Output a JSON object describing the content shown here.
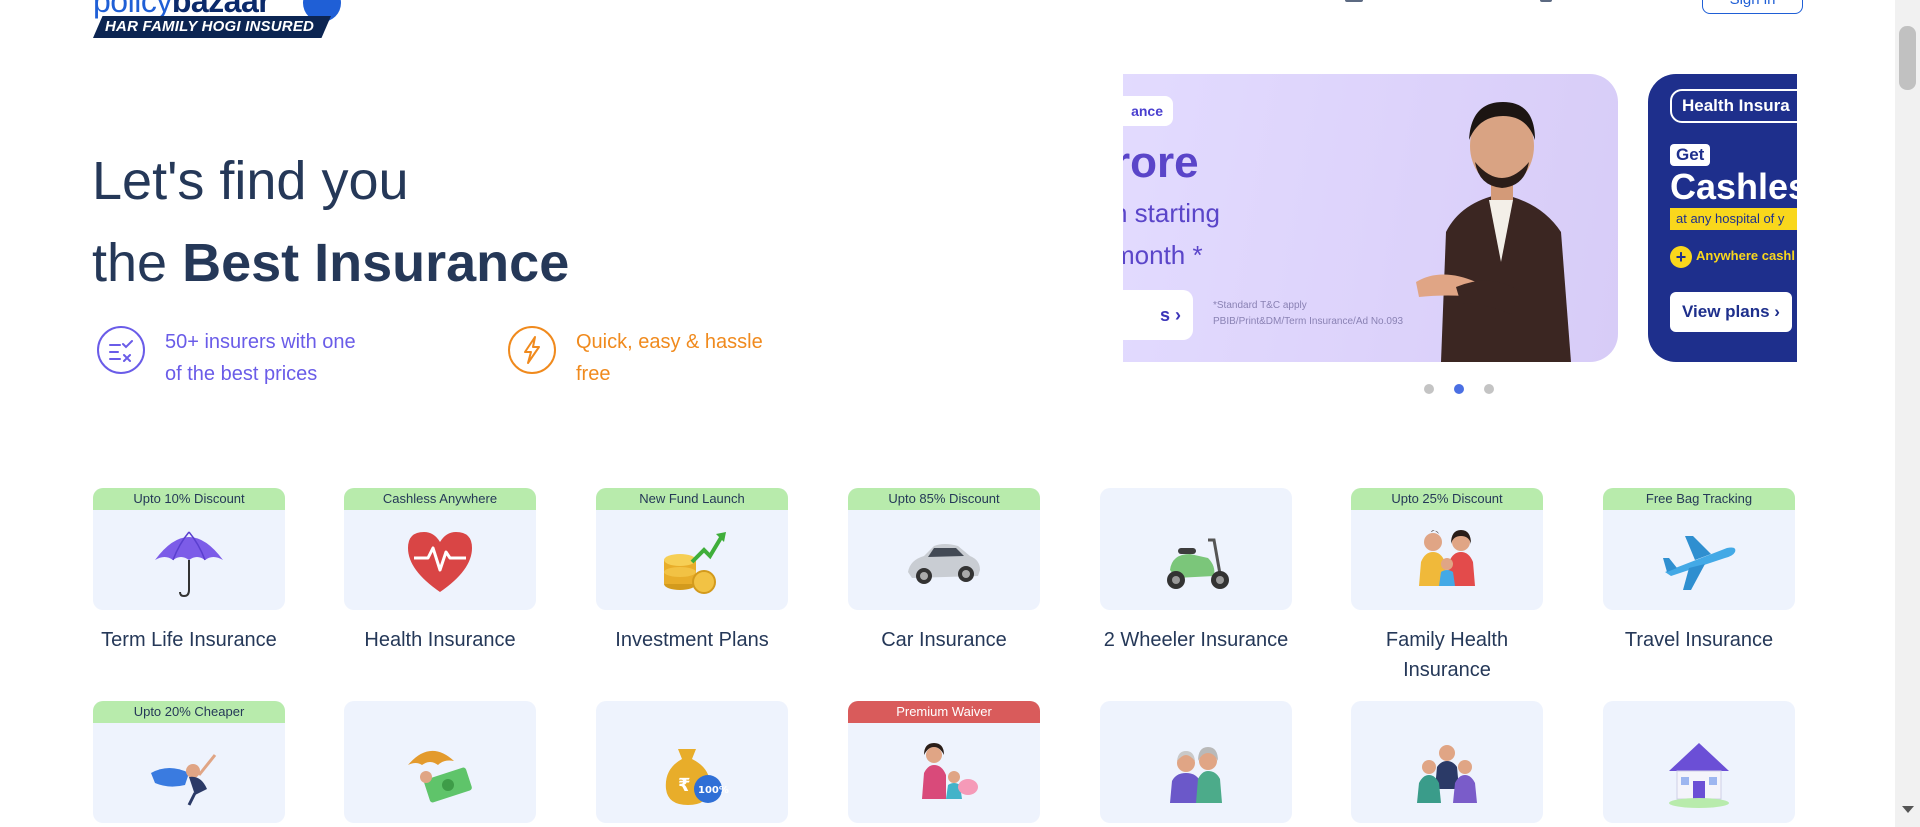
{
  "header": {
    "logo_part1": "policy",
    "logo_part2": "bazaar",
    "logo_tagline": "HAR FAMILY HOGI INSURED",
    "signin_label": "Sign in"
  },
  "hero": {
    "title_line1": "Let's find you",
    "title_line2_prefix": "the ",
    "title_line2_bold": "Best Insurance",
    "features": [
      {
        "icon": "compare-list-icon",
        "text": "50+ insurers with one of the best prices",
        "color": "#6a5ce8"
      },
      {
        "icon": "lightning-icon",
        "text": "Quick, easy & hassle free",
        "color": "#f08a1d"
      }
    ]
  },
  "carousel": {
    "slide1": {
      "badge": "ance",
      "big": "rore",
      "line1": "n starting",
      "line2": "month *",
      "button": "s",
      "tc_line1": "*Standard T&C apply",
      "tc_line2": "PBIB/Print&DM/Term Insurance/Ad No.093"
    },
    "slide2": {
      "badge": "Health Insura",
      "get": "Get",
      "big": "Cashles",
      "yellow": "at any hospital of y",
      "cashless_note": "Anywhere cashl",
      "button": "View plans"
    },
    "active_dot": 2,
    "dot_count": 3
  },
  "products": {
    "row1": [
      {
        "badge": "Upto 10% Discount",
        "label": "Term Life Insurance",
        "icon": "umbrella-icon"
      },
      {
        "badge": "Cashless Anywhere",
        "label": "Health Insurance",
        "icon": "heart-pulse-icon"
      },
      {
        "badge": "New Fund Launch",
        "label": "Investment Plans",
        "icon": "coins-growth-icon"
      },
      {
        "badge": "Upto 85% Discount",
        "label": "Car Insurance",
        "icon": "car-icon"
      },
      {
        "badge": "",
        "label": "2 Wheeler Insurance",
        "icon": "scooter-icon"
      },
      {
        "badge": "Upto 25% Discount",
        "label": "Family Health Insurance",
        "icon": "family-icon"
      },
      {
        "badge": "Free Bag Tracking",
        "label": "Travel Insurance",
        "icon": "airplane-icon"
      }
    ],
    "row2": [
      {
        "badge": "Upto 20% Cheaper",
        "icon": "superhero-icon"
      },
      {
        "badge": "",
        "icon": "money-umbrella-icon"
      },
      {
        "badge": "",
        "icon": "money-bag-icon"
      },
      {
        "badge": "Premium Waiver",
        "icon": "mother-child-icon"
      },
      {
        "badge": "",
        "icon": "senior-couple-icon"
      },
      {
        "badge": "",
        "icon": "employee-group-icon"
      },
      {
        "badge": "",
        "icon": "house-icon"
      }
    ]
  },
  "colors": {
    "brand_blue": "#1f5fd6",
    "navy": "#253858",
    "badge_green": "#b8ebac",
    "badge_red": "#d95b5b",
    "card_bg": "#eef3fd"
  }
}
